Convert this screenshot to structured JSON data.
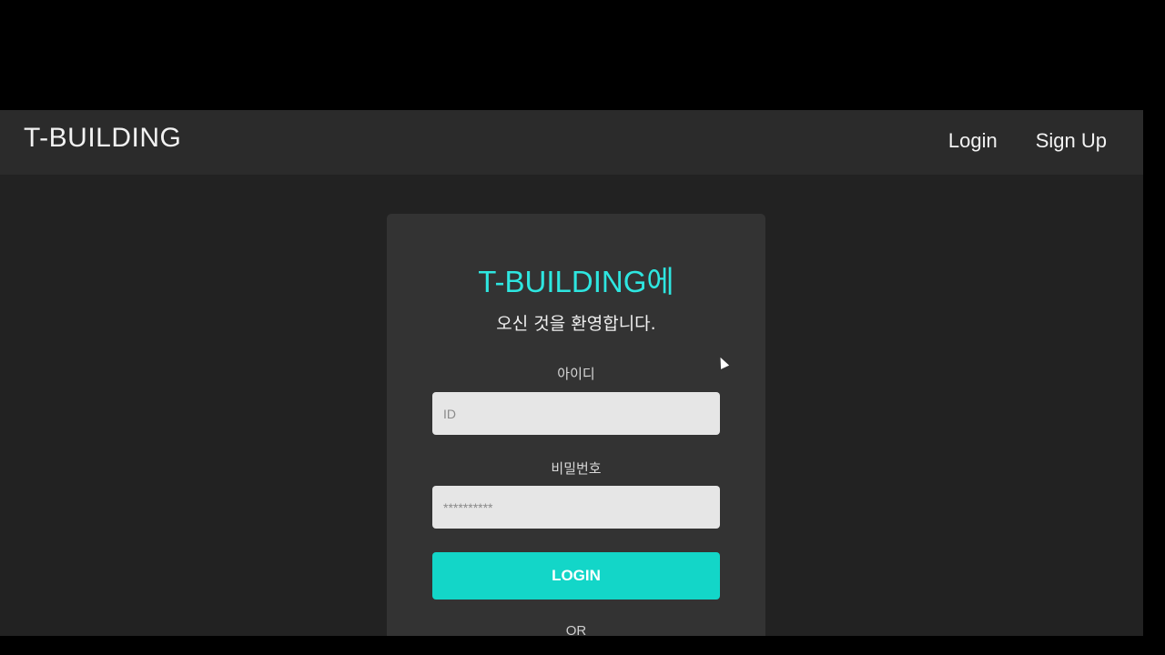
{
  "navbar": {
    "brand": "T-BUILDING",
    "links": [
      "Login",
      "Sign Up"
    ]
  },
  "login_card": {
    "title": "T-BUILDING에",
    "subtitle": "오신 것을 환영합니다.",
    "id_label": "아이디",
    "id_placeholder": "ID",
    "password_label": "비밀번호",
    "password_placeholder": "**********",
    "login_button": "LOGIN",
    "or_text": "OR"
  },
  "colors": {
    "accent": "#2ee6e0",
    "button": "#13d6c8",
    "card_bg": "#333333",
    "page_bg": "#222222"
  }
}
